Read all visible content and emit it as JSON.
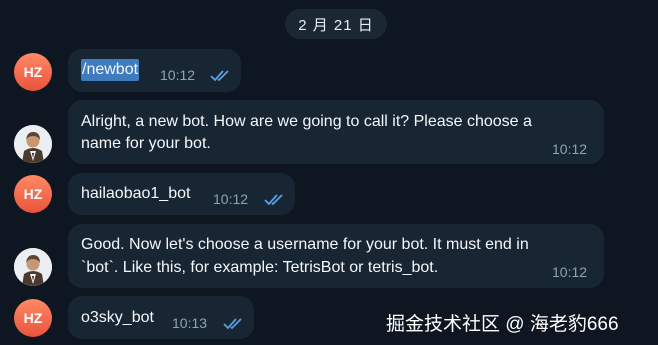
{
  "date_separator": "2 月 21 日",
  "messages": [
    {
      "sender": "HZ",
      "text": "/newbot",
      "time": "10:12"
    },
    {
      "sender": "bot",
      "line1": "Alright, a new bot. How are we going to call it? Please choose a",
      "line2": "name for your bot.",
      "time": "10:12"
    },
    {
      "sender": "HZ",
      "text": "hailaobao1_bot",
      "time": "10:12"
    },
    {
      "sender": "bot",
      "line1": "Good. Now let's choose a username for your bot. It must end in",
      "line2": "`bot`. Like this, for example: TetrisBot or tetris_bot.",
      "time": "10:12"
    },
    {
      "sender": "HZ",
      "text": "o3sky_bot",
      "time": "10:13"
    }
  ],
  "watermark": "掘金技术社区 @ 海老豹666",
  "colors": {
    "background": "#0e1621",
    "bubble": "#182533",
    "selection": "#3e7bbf",
    "time": "#8ea4b8",
    "ticks": "#5aa0e6",
    "avatar_hz": "#e9533c"
  }
}
